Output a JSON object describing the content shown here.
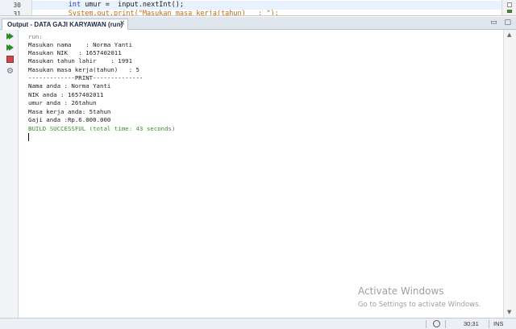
{
  "editor": {
    "line_numbers": [
      "30",
      "31"
    ],
    "line_30": {
      "indent": "      ",
      "keyword": "int",
      "rest": " umur =  input.nextInt();"
    },
    "line_31": {
      "indent": "      ",
      "text": "System.out.print(\"Masukan masa kerja(tahun)   : \");"
    }
  },
  "output_panel": {
    "tab_label": "Output - DATA GAJI KARYAWAN (run)",
    "close_glyph": "×",
    "window_glyphs": "▭ ▢",
    "console_lines": [
      {
        "text": "run:",
        "style": "muted"
      },
      {
        "text": "Masukan nama    : Norma Yanti",
        "style": "normal"
      },
      {
        "text": "Masukan NIK   : 1657402011",
        "style": "normal"
      },
      {
        "text": "Masukan tahun lahir    : 1991",
        "style": "normal"
      },
      {
        "text": "Masukan masa kerja(tahun)   : 5",
        "style": "normal"
      },
      {
        "text": "-------------PRINT--------------",
        "style": "normal"
      },
      {
        "text": "Nama anda : Norma Yanti",
        "style": "normal"
      },
      {
        "text": "NIK anda : 1657402011",
        "style": "normal"
      },
      {
        "text": "umur anda : 26tahun",
        "style": "normal"
      },
      {
        "text": "Masa kerja anda: 5tahun",
        "style": "normal"
      },
      {
        "text": "Gaji anda :Rp.6.000.000",
        "style": "normal"
      },
      {
        "text": "BUILD SUCCESSFUL (total time: 43 seconds)",
        "style": "green"
      }
    ]
  },
  "toolbar": {
    "buttons": [
      {
        "name": "rerun-icon"
      },
      {
        "name": "rerun-with-options-icon"
      },
      {
        "name": "stop-icon"
      },
      {
        "name": "settings-icon",
        "glyph": "⚙"
      }
    ]
  },
  "watermark": {
    "title": "Activate Windows",
    "subtitle": "Go to Settings to activate Windows."
  },
  "statusbar": {
    "caret_position": "30:31",
    "insert_mode": "INS"
  },
  "colors": {
    "build_success": "#3b8f2c",
    "run_green": "#2e8a2a",
    "stop_red": "#c94a4a",
    "keyword_blue": "#1f3cb8"
  }
}
